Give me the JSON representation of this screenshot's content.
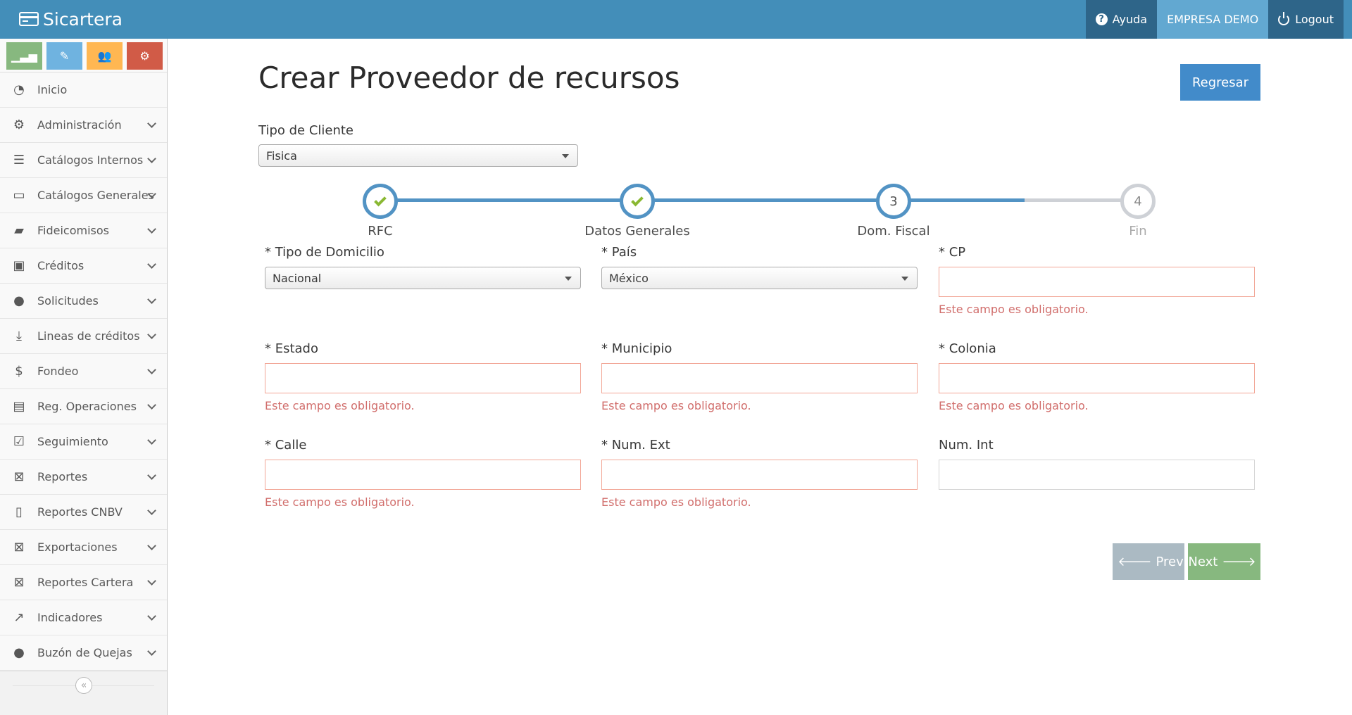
{
  "navbar": {
    "brand": "Sicartera",
    "help_label": "Ayuda",
    "company_label": "EMPRESA DEMO",
    "logout_label": "Logout"
  },
  "sidebar": {
    "items": [
      {
        "label": "Inicio",
        "icon": "dashboard-icon",
        "glyph": "◔"
      },
      {
        "label": "Administración",
        "icon": "gears-icon",
        "glyph": "⚙"
      },
      {
        "label": "Catálogos Internos",
        "icon": "database-icon",
        "glyph": "☰"
      },
      {
        "label": "Catálogos Generales",
        "icon": "desktop-icon",
        "glyph": "▭"
      },
      {
        "label": "Fideicomisos",
        "icon": "folder-open-icon",
        "glyph": "▰"
      },
      {
        "label": "Créditos",
        "icon": "briefcase-icon",
        "glyph": "▣"
      },
      {
        "label": "Solicitudes",
        "icon": "user-icon",
        "glyph": "●"
      },
      {
        "label": "Lineas de créditos",
        "icon": "download-icon",
        "glyph": "⤓"
      },
      {
        "label": "Fondeo",
        "icon": "dollar-icon",
        "glyph": "$"
      },
      {
        "label": "Reg. Operaciones",
        "icon": "file-text-icon",
        "glyph": "▤"
      },
      {
        "label": "Seguimiento",
        "icon": "check-square-icon",
        "glyph": "☑"
      },
      {
        "label": "Reportes",
        "icon": "file-excel-icon",
        "glyph": "⊠"
      },
      {
        "label": "Reportes CNBV",
        "icon": "file-icon",
        "glyph": "▯"
      },
      {
        "label": "Exportaciones",
        "icon": "file-excel-icon",
        "glyph": "⊠"
      },
      {
        "label": "Reportes Cartera",
        "icon": "file-excel-icon",
        "glyph": "⊠"
      },
      {
        "label": "Indicadores",
        "icon": "line-chart-icon",
        "glyph": "↗"
      },
      {
        "label": "Buzón de Quejas",
        "icon": "comment-icon",
        "glyph": "●"
      }
    ]
  },
  "page": {
    "title": "Crear Proveedor de recursos",
    "back_button": "Regresar",
    "tipo_cliente_label": "Tipo de Cliente",
    "tipo_cliente_value": "Fisica"
  },
  "wizard": {
    "steps": [
      {
        "label": "RFC",
        "state": "complete",
        "number": ""
      },
      {
        "label": "Datos Generales",
        "state": "complete",
        "number": ""
      },
      {
        "label": "Dom. Fiscal",
        "state": "active",
        "number": "3"
      },
      {
        "label": "Fin",
        "state": "pending",
        "number": "4"
      }
    ],
    "progress_percent": 85,
    "active_color": "#5293c4",
    "pending_color": "#ced1d6"
  },
  "form": {
    "required_error": "Este campo es obligatorio.",
    "tipo_domicilio_label": "* Tipo de Domicilio",
    "tipo_domicilio_value": "Nacional",
    "pais_label": "* País",
    "pais_value": "México",
    "cp_label": "* CP",
    "estado_label": "* Estado",
    "municipio_label": "* Municipio",
    "colonia_label": "* Colonia",
    "calle_label": "* Calle",
    "num_ext_label": "* Num. Ext",
    "num_int_label": "Num. Int"
  },
  "footer_buttons": {
    "prev": "Prev",
    "next": "Next"
  }
}
